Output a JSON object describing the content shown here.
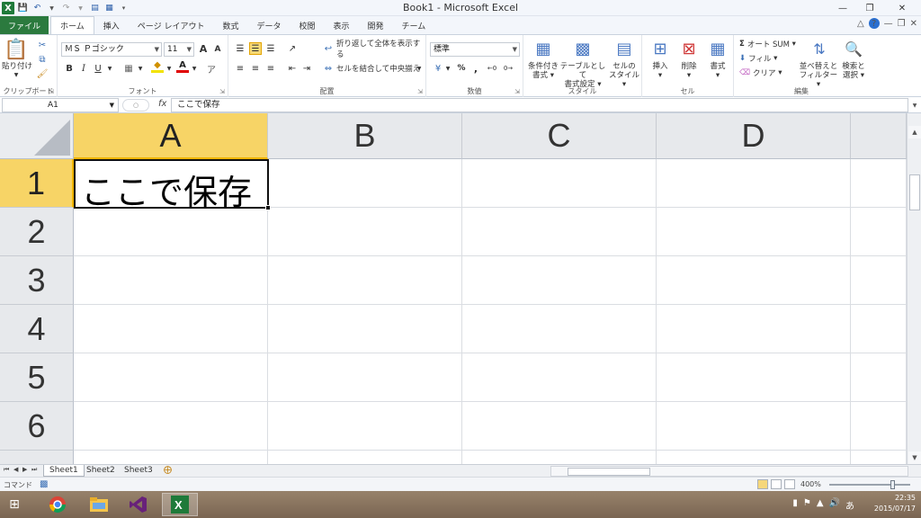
{
  "window": {
    "title": "Book1  -  Microsoft Excel"
  },
  "tabs": [
    {
      "label": "ファイル"
    },
    {
      "label": "ホーム"
    },
    {
      "label": "挿入"
    },
    {
      "label": "ページ レイアウト"
    },
    {
      "label": "数式"
    },
    {
      "label": "データ"
    },
    {
      "label": "校閲"
    },
    {
      "label": "表示"
    },
    {
      "label": "開発"
    },
    {
      "label": "チーム"
    }
  ],
  "ribbon": {
    "clipboard": {
      "paste": "貼り付け",
      "group": "クリップボード"
    },
    "font": {
      "name": "ＭＳ Ｐゴシック",
      "size": "11",
      "bold": "B",
      "italic": "I",
      "underline": "U",
      "grow": "A",
      "shrink": "A",
      "group": "フォント"
    },
    "alignment": {
      "wrap": "折り返して全体を表示する",
      "merge": "セルを結合して中央揃え",
      "group": "配置"
    },
    "number": {
      "format": "標準",
      "percent": "%",
      "comma": ",",
      "group": "数値"
    },
    "styles": {
      "conditional": [
        "条件付き",
        "書式"
      ],
      "table": [
        "テーブルとして",
        "書式設定"
      ],
      "cell": [
        "セルの",
        "スタイル"
      ],
      "group": "スタイル"
    },
    "cells": {
      "insert": "挿入",
      "delete": "削除",
      "format": "書式",
      "group": "セル"
    },
    "editing": {
      "autosum": "オート SUM",
      "fill": "フィル",
      "clear": "クリア",
      "sort": [
        "並べ替えと",
        "フィルター"
      ],
      "find": [
        "検索と",
        "選択"
      ],
      "group": "編集"
    }
  },
  "formula_bar": {
    "name_box": "A1",
    "fx": "fx",
    "formula": "ここで保存"
  },
  "grid": {
    "columns": [
      "A",
      "B",
      "C",
      "D"
    ],
    "rows": [
      "1",
      "2",
      "3",
      "4",
      "5",
      "6"
    ],
    "active_cell": "A1",
    "cells": {
      "A1": "ここで保存"
    }
  },
  "sheets": [
    {
      "label": "Sheet1"
    },
    {
      "label": "Sheet2"
    },
    {
      "label": "Sheet3"
    }
  ],
  "status": {
    "mode": "コマンド",
    "zoom": "400%"
  },
  "taskbar": {
    "time": "22:35",
    "date": "2015/07/17",
    "ime": "あ"
  },
  "colors": {
    "file_tab": "#2b7a3e",
    "selected_header": "#f7d466"
  }
}
